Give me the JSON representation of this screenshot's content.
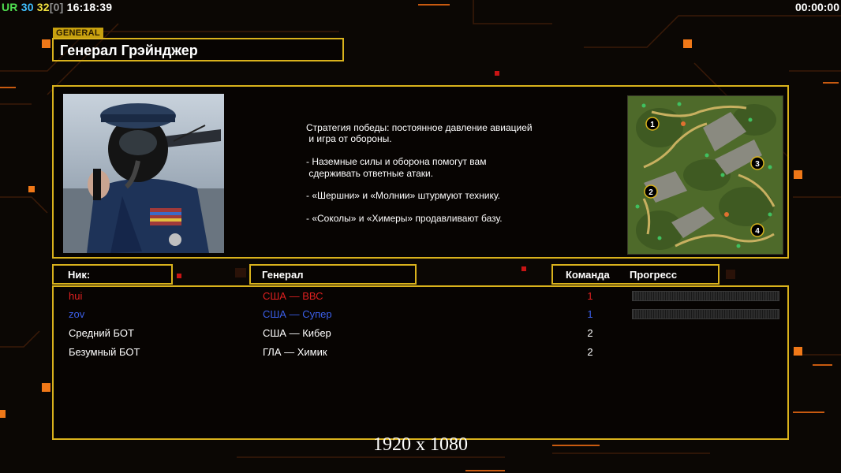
{
  "hud": {
    "label": "UR",
    "value_a": "30",
    "value_b": "32",
    "bracket": "[0]",
    "clock": "16:18:39",
    "timer": "00:00:00"
  },
  "header": {
    "tag": "GENERAL",
    "title": "Генерал Грэйнджер"
  },
  "strategy_text": "Стратегия победы: постоянное давление авиацией\n и игра от обороны.\n\n- Наземные силы и оборона помогут вам\n сдерживать ответные атаки.\n\n- «Шершни» и «Молнии» штурмуют технику.\n\n- «Соколы» и «Химеры» продавливают базу.",
  "minimap": {
    "start_positions": [
      "1",
      "2",
      "3",
      "4"
    ]
  },
  "columns": {
    "nick": "Ник:",
    "general": "Генерал",
    "team": "Команда",
    "progress": "Прогресс"
  },
  "players": [
    {
      "nick": "hui",
      "general": "США — ВВС",
      "team": "1",
      "color": "#e02020",
      "progress": 0
    },
    {
      "nick": "zov",
      "general": "США — Супер",
      "team": "1",
      "color": "#3b5fe8",
      "progress": 0
    },
    {
      "nick": "Средний БОТ",
      "general": "США — Кибер",
      "team": "2",
      "color": "#ffffff"
    },
    {
      "nick": "Безумный БОТ",
      "general": "ГЛА — Химик",
      "team": "2",
      "color": "#ffffff"
    }
  ],
  "resolution": "1920 x 1080",
  "colors": {
    "accent_gold": "#d9b21c",
    "deco_orange": "#f07818",
    "hud_green": "#50e050",
    "hud_cyan": "#40c0ff",
    "hud_yellow": "#f0e040",
    "hud_grey": "#909090"
  }
}
